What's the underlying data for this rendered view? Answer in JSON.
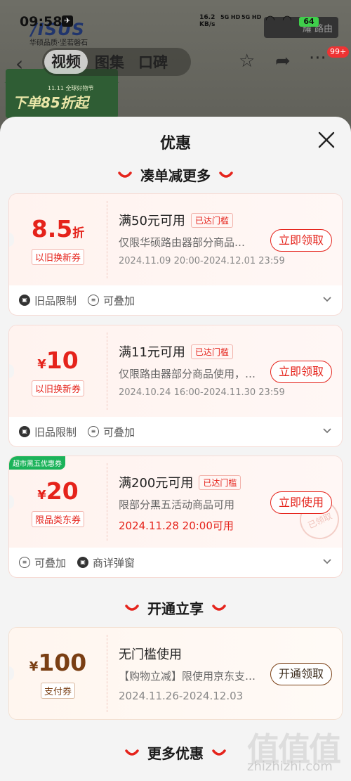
{
  "status": {
    "time": "09:58",
    "net_speed": "16.2",
    "net_unit": "KB/s",
    "sig1": "5G HD",
    "sig2": "5G HD",
    "battery": "64"
  },
  "background": {
    "brand": "/ISUS",
    "brand_sub": "华硕品质·坚若磐石",
    "promo_small": "11.11 全球好物节",
    "promo_text": "下单85折起",
    "router_btn": "耀 路由"
  },
  "nav": {
    "tabs": [
      "视频",
      "图集",
      "口碑"
    ],
    "badge": "99+"
  },
  "sheet": {
    "title": "优惠",
    "sections": [
      "凑单减更多",
      "开通立享",
      "更多优惠"
    ],
    "coupons": [
      {
        "amount": "8.5",
        "unit": "折",
        "tag": "以旧换新券",
        "condition": "满50元可用",
        "reached": "已达门槛",
        "desc": "仅限华硕路由器部分商品…",
        "date": "2024.11.09 20:00-2024.12.01 23:59",
        "action": "立即领取",
        "foot": [
          "旧品限制",
          "可叠加"
        ]
      },
      {
        "prefix": "¥",
        "amount": "10",
        "tag": "以旧换新券",
        "condition": "满11元可用",
        "reached": "已达门槛",
        "desc": "仅限路由器部分商品使用，…",
        "date": "2024.10.24 16:00-2024.11.30 23:59",
        "action": "立即领取",
        "foot": [
          "旧品限制",
          "可叠加"
        ]
      },
      {
        "badge": "超市黑五优惠券",
        "prefix": "¥",
        "amount": "20",
        "tag": "限品类东券",
        "condition": "满200元可用",
        "reached": "已达门槛",
        "desc": "限部分黑五活动商品可用",
        "date": "2024.11.28 20:00可用",
        "action": "立即使用",
        "stamp": "已领取",
        "foot": [
          "可叠加",
          "商详弹窗"
        ]
      },
      {
        "prefix": "¥",
        "amount": "100",
        "tag": "支付券",
        "condition": "无门槛使用",
        "desc": "【购物立减】限使用京东支…",
        "date": "2024.11.26-2024.12.03",
        "action": "开通领取"
      }
    ]
  },
  "watermark": {
    "logo": "值值值",
    "site": "zhizhizhi.com"
  },
  "colors": {
    "accent": "#e5231b",
    "pay": "#7a3f14",
    "badge_green": "#1bb35a"
  }
}
